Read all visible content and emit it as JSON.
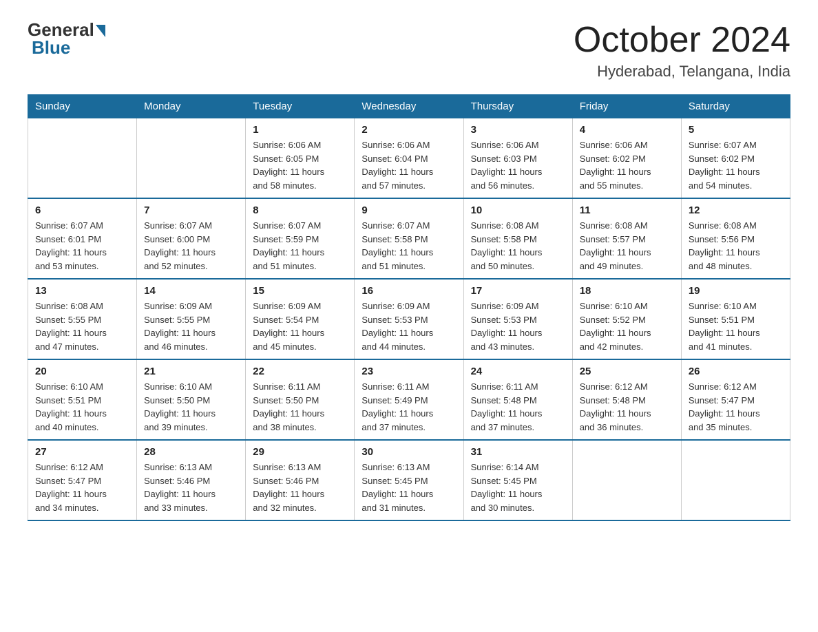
{
  "header": {
    "logo_general": "General",
    "logo_blue": "Blue",
    "month_title": "October 2024",
    "location": "Hyderabad, Telangana, India"
  },
  "weekdays": [
    "Sunday",
    "Monday",
    "Tuesday",
    "Wednesday",
    "Thursday",
    "Friday",
    "Saturday"
  ],
  "weeks": [
    [
      {
        "day": "",
        "info": ""
      },
      {
        "day": "",
        "info": ""
      },
      {
        "day": "1",
        "info": "Sunrise: 6:06 AM\nSunset: 6:05 PM\nDaylight: 11 hours\nand 58 minutes."
      },
      {
        "day": "2",
        "info": "Sunrise: 6:06 AM\nSunset: 6:04 PM\nDaylight: 11 hours\nand 57 minutes."
      },
      {
        "day": "3",
        "info": "Sunrise: 6:06 AM\nSunset: 6:03 PM\nDaylight: 11 hours\nand 56 minutes."
      },
      {
        "day": "4",
        "info": "Sunrise: 6:06 AM\nSunset: 6:02 PM\nDaylight: 11 hours\nand 55 minutes."
      },
      {
        "day": "5",
        "info": "Sunrise: 6:07 AM\nSunset: 6:02 PM\nDaylight: 11 hours\nand 54 minutes."
      }
    ],
    [
      {
        "day": "6",
        "info": "Sunrise: 6:07 AM\nSunset: 6:01 PM\nDaylight: 11 hours\nand 53 minutes."
      },
      {
        "day": "7",
        "info": "Sunrise: 6:07 AM\nSunset: 6:00 PM\nDaylight: 11 hours\nand 52 minutes."
      },
      {
        "day": "8",
        "info": "Sunrise: 6:07 AM\nSunset: 5:59 PM\nDaylight: 11 hours\nand 51 minutes."
      },
      {
        "day": "9",
        "info": "Sunrise: 6:07 AM\nSunset: 5:58 PM\nDaylight: 11 hours\nand 51 minutes."
      },
      {
        "day": "10",
        "info": "Sunrise: 6:08 AM\nSunset: 5:58 PM\nDaylight: 11 hours\nand 50 minutes."
      },
      {
        "day": "11",
        "info": "Sunrise: 6:08 AM\nSunset: 5:57 PM\nDaylight: 11 hours\nand 49 minutes."
      },
      {
        "day": "12",
        "info": "Sunrise: 6:08 AM\nSunset: 5:56 PM\nDaylight: 11 hours\nand 48 minutes."
      }
    ],
    [
      {
        "day": "13",
        "info": "Sunrise: 6:08 AM\nSunset: 5:55 PM\nDaylight: 11 hours\nand 47 minutes."
      },
      {
        "day": "14",
        "info": "Sunrise: 6:09 AM\nSunset: 5:55 PM\nDaylight: 11 hours\nand 46 minutes."
      },
      {
        "day": "15",
        "info": "Sunrise: 6:09 AM\nSunset: 5:54 PM\nDaylight: 11 hours\nand 45 minutes."
      },
      {
        "day": "16",
        "info": "Sunrise: 6:09 AM\nSunset: 5:53 PM\nDaylight: 11 hours\nand 44 minutes."
      },
      {
        "day": "17",
        "info": "Sunrise: 6:09 AM\nSunset: 5:53 PM\nDaylight: 11 hours\nand 43 minutes."
      },
      {
        "day": "18",
        "info": "Sunrise: 6:10 AM\nSunset: 5:52 PM\nDaylight: 11 hours\nand 42 minutes."
      },
      {
        "day": "19",
        "info": "Sunrise: 6:10 AM\nSunset: 5:51 PM\nDaylight: 11 hours\nand 41 minutes."
      }
    ],
    [
      {
        "day": "20",
        "info": "Sunrise: 6:10 AM\nSunset: 5:51 PM\nDaylight: 11 hours\nand 40 minutes."
      },
      {
        "day": "21",
        "info": "Sunrise: 6:10 AM\nSunset: 5:50 PM\nDaylight: 11 hours\nand 39 minutes."
      },
      {
        "day": "22",
        "info": "Sunrise: 6:11 AM\nSunset: 5:50 PM\nDaylight: 11 hours\nand 38 minutes."
      },
      {
        "day": "23",
        "info": "Sunrise: 6:11 AM\nSunset: 5:49 PM\nDaylight: 11 hours\nand 37 minutes."
      },
      {
        "day": "24",
        "info": "Sunrise: 6:11 AM\nSunset: 5:48 PM\nDaylight: 11 hours\nand 37 minutes."
      },
      {
        "day": "25",
        "info": "Sunrise: 6:12 AM\nSunset: 5:48 PM\nDaylight: 11 hours\nand 36 minutes."
      },
      {
        "day": "26",
        "info": "Sunrise: 6:12 AM\nSunset: 5:47 PM\nDaylight: 11 hours\nand 35 minutes."
      }
    ],
    [
      {
        "day": "27",
        "info": "Sunrise: 6:12 AM\nSunset: 5:47 PM\nDaylight: 11 hours\nand 34 minutes."
      },
      {
        "day": "28",
        "info": "Sunrise: 6:13 AM\nSunset: 5:46 PM\nDaylight: 11 hours\nand 33 minutes."
      },
      {
        "day": "29",
        "info": "Sunrise: 6:13 AM\nSunset: 5:46 PM\nDaylight: 11 hours\nand 32 minutes."
      },
      {
        "day": "30",
        "info": "Sunrise: 6:13 AM\nSunset: 5:45 PM\nDaylight: 11 hours\nand 31 minutes."
      },
      {
        "day": "31",
        "info": "Sunrise: 6:14 AM\nSunset: 5:45 PM\nDaylight: 11 hours\nand 30 minutes."
      },
      {
        "day": "",
        "info": ""
      },
      {
        "day": "",
        "info": ""
      }
    ]
  ]
}
